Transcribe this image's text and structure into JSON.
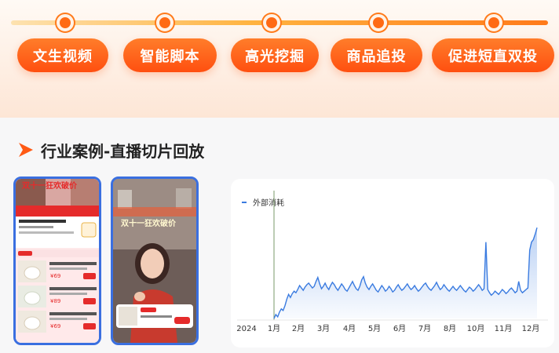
{
  "steps": [
    {
      "label": "文生视频"
    },
    {
      "label": "智能脚本"
    },
    {
      "label": "高光挖掘"
    },
    {
      "label": "商品追投"
    },
    {
      "label": "促进短直双投"
    }
  ],
  "section": {
    "title": "行业案例-直播切片回放"
  },
  "phone1": {
    "banner": "双十一狂欢破价"
  },
  "phone2": {
    "banner": "双十一狂欢破价"
  },
  "colors": {
    "accent": "#ff5a14",
    "line": "#3a7be0",
    "phone_border": "#3a6fe0"
  },
  "chart_data": {
    "type": "area",
    "series": [
      {
        "name": "外部消耗",
        "values": [
          0.0,
          0.5,
          0.2,
          0.8,
          1.2,
          1.0,
          1.6,
          2.4,
          3.0,
          2.6,
          3.1,
          3.4,
          3.2,
          3.6,
          4.1,
          3.8,
          3.5,
          3.9,
          4.2,
          4.4,
          4.1,
          3.8,
          4.0,
          4.6,
          5.1,
          4.3,
          3.7,
          4.0,
          4.4,
          3.9,
          3.6,
          4.1,
          4.5,
          4.2,
          3.8,
          3.5,
          3.9,
          4.3,
          4.0,
          3.6,
          3.4,
          3.8,
          4.2,
          4.6,
          4.1,
          3.7,
          3.5,
          4.0,
          4.8,
          5.2,
          4.4,
          3.9,
          3.6,
          4.0,
          4.3,
          3.9,
          3.5,
          3.3,
          3.7,
          4.1,
          3.8,
          3.4,
          3.6,
          4.0,
          3.7,
          3.3,
          3.5,
          3.9,
          4.2,
          3.8,
          3.5,
          3.7,
          4.0,
          4.3,
          3.9,
          3.6,
          3.8,
          4.1,
          3.7,
          3.4,
          3.6,
          3.9,
          4.2,
          4.4,
          4.0,
          3.7,
          3.5,
          3.8,
          4.1,
          4.5,
          4.0,
          3.6,
          3.8,
          4.2,
          3.9,
          3.6,
          3.4,
          3.7,
          4.0,
          3.7,
          3.5,
          3.8,
          4.1,
          3.8,
          3.5,
          3.3,
          3.6,
          3.9,
          3.7,
          3.4,
          3.6,
          3.9,
          4.2,
          3.9,
          3.5,
          3.7,
          9.5,
          3.6,
          3.2,
          2.9,
          3.1,
          3.4,
          3.2,
          3.0,
          3.3,
          3.6,
          3.4,
          3.1,
          3.3,
          3.6,
          3.8,
          3.5,
          3.2,
          3.4,
          4.6,
          3.5,
          3.2,
          3.4,
          3.6,
          3.8,
          8.5,
          9.5,
          9.8,
          10.5,
          11.3
        ]
      }
    ],
    "x_ticks": [
      "2024",
      "1月",
      "2月",
      "3月",
      "4月",
      "5月",
      "6月",
      "7月",
      "8月",
      "10月",
      "11月",
      "12月"
    ],
    "ylim": [
      0,
      12
    ]
  }
}
